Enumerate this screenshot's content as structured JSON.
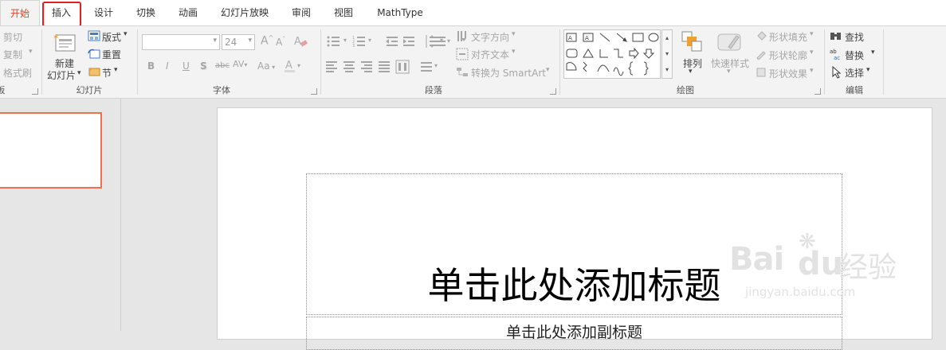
{
  "tabs": [
    {
      "label": "开始",
      "active": true
    },
    {
      "label": "插入"
    },
    {
      "label": "设计"
    },
    {
      "label": "切换"
    },
    {
      "label": "动画"
    },
    {
      "label": "幻灯片放映"
    },
    {
      "label": "审阅"
    },
    {
      "label": "视图"
    },
    {
      "label": "MathType"
    }
  ],
  "clipboard": {
    "cut": "剪切",
    "copy": "复制",
    "format_painter": "格式刷",
    "label_partial": "板"
  },
  "slides_group": {
    "new_slide_line1": "新建",
    "new_slide_line2": "幻灯片",
    "layout": "版式",
    "reset": "重置",
    "section": "节",
    "label": "幻灯片"
  },
  "font_group": {
    "font_name": "",
    "font_size": "24",
    "bold": "B",
    "italic": "I",
    "underline": "U",
    "shadow": "S",
    "strikethrough": "abc",
    "spacing": "AV",
    "change_case": "Aa",
    "grow": "A",
    "shrink": "A",
    "label": "字体"
  },
  "paragraph_group": {
    "text_direction": "文字方向",
    "align_text": "对齐文本",
    "convert_smartart": "转换为 SmartArt",
    "label": "段落"
  },
  "drawing_group": {
    "arrange": "排列",
    "quick_styles": "快速样式",
    "shape_fill": "形状填充",
    "shape_outline": "形状轮廓",
    "shape_effects": "形状效果",
    "label": "绘图"
  },
  "editing_group": {
    "find": "查找",
    "replace": "替换",
    "select": "选择",
    "label": "编辑"
  },
  "slide": {
    "title_placeholder": "单击此处添加标题",
    "subtitle_placeholder": "单击此处添加副标题"
  },
  "watermark": {
    "brand": "Bai",
    "brand2": "du",
    "product": "经验",
    "url": "jingyan.baidu.com"
  },
  "colors": {
    "accent": "#d24726",
    "highlight": "#e02020",
    "thumb_border": "#f07050"
  }
}
